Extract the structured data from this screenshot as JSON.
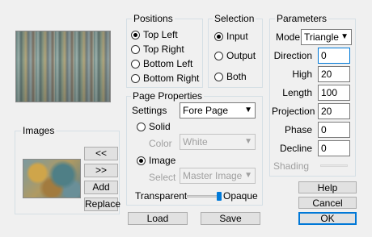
{
  "left": {
    "images_label": "Images",
    "prev_button": "<<",
    "next_button": ">>",
    "add_button": "Add",
    "replace_button": "Replace"
  },
  "positions": {
    "title": "Positions",
    "options": [
      "Top Left",
      "Top Right",
      "Bottom Left",
      "Bottom Right"
    ],
    "selected": "Top Left"
  },
  "selection": {
    "title": "Selection",
    "options": [
      "Input",
      "Output",
      "Both"
    ],
    "selected": "Input"
  },
  "page_properties": {
    "title": "Page Properties",
    "settings_label": "Settings",
    "settings_value": "Fore Page",
    "solid_label": "Solid",
    "color_label": "Color",
    "color_value": "White",
    "image_label": "Image",
    "select_label": "Select",
    "select_value": "Master Image",
    "mode_selected": "Image",
    "transparent_label": "Transparent",
    "opaque_label": "Opaque",
    "opacity": 0.95
  },
  "parameters": {
    "title": "Parameters",
    "mode_label": "Mode",
    "mode_value": "Triangle",
    "direction_label": "Direction",
    "direction_value": "0",
    "high_label": "High",
    "high_value": "20",
    "length_label": "Length",
    "length_value": "100",
    "projection_label": "Projection",
    "projection_value": "20",
    "phase_label": "Phase",
    "phase_value": "0",
    "decline_label": "Decline",
    "decline_value": "0",
    "shading_label": "Shading"
  },
  "buttons": {
    "load": "Load",
    "save": "Save",
    "help": "Help",
    "cancel": "Cancel",
    "ok": "OK"
  }
}
